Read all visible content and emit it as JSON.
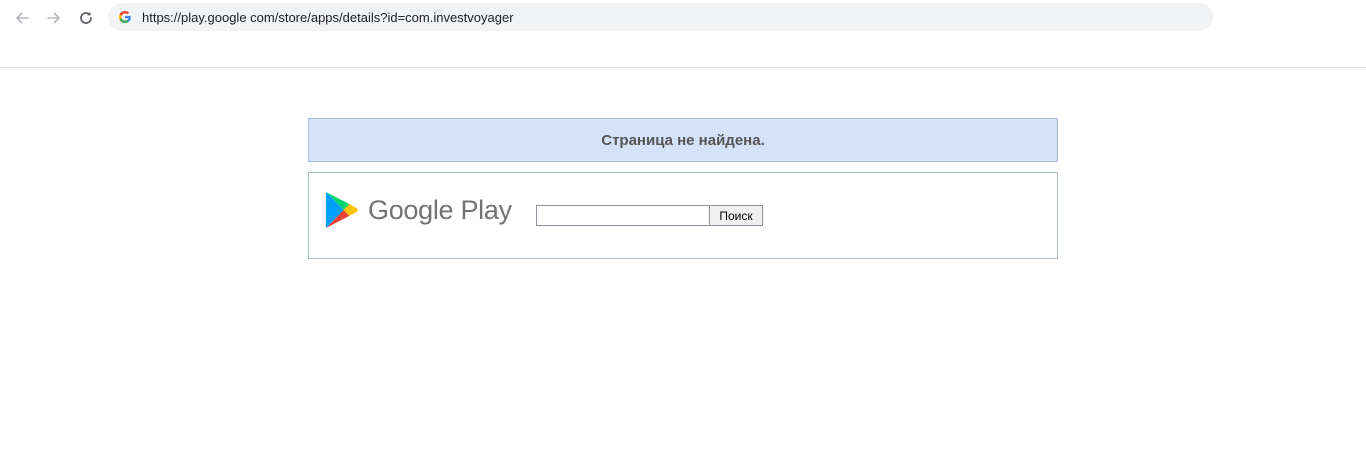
{
  "browser": {
    "url": "https://play.google com/store/apps/details?id=com.investvoyager"
  },
  "page": {
    "notice": "Страница не найдена.",
    "logo_text": "Google Play",
    "search": {
      "value": "",
      "placeholder": "",
      "button_label": "Поиск"
    }
  },
  "icons": {
    "back": "arrow-left-icon",
    "forward": "arrow-right-icon",
    "reload": "reload-icon",
    "site": "google-g-icon",
    "logo": "google-play-triangle-icon"
  },
  "colors": {
    "notice_bg": "#d4e3f8",
    "border": "#a9bcd3",
    "notice_text": "#555555",
    "logo_text": "#737373",
    "omnibox_bg": "#f1f3f4"
  }
}
